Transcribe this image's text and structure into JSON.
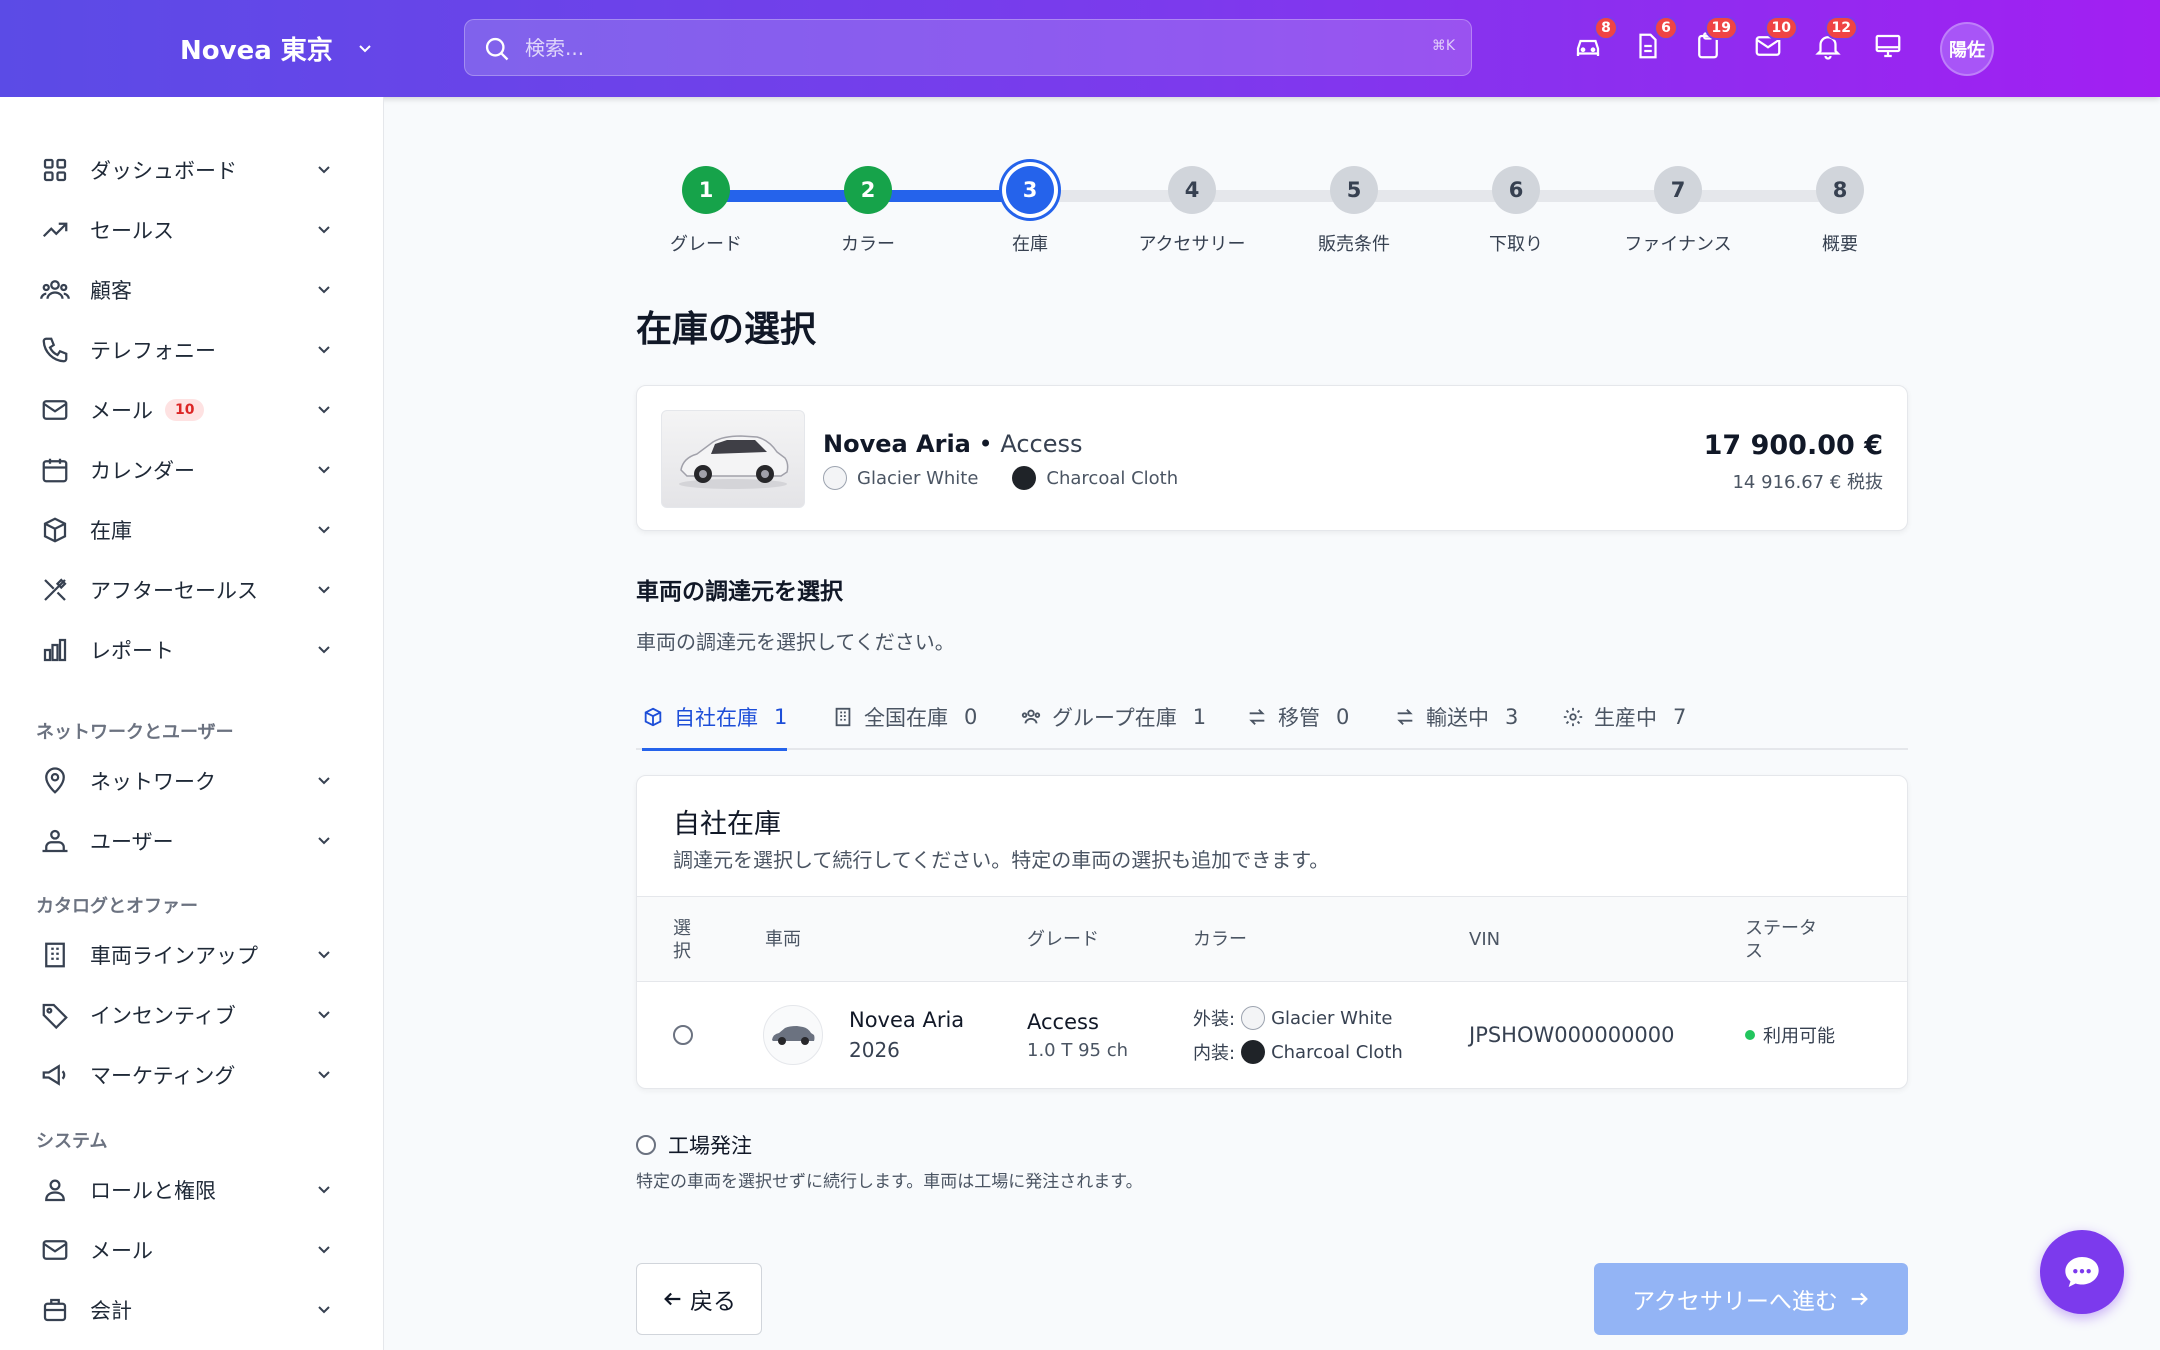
{
  "header": {
    "brand": "Novea 東京",
    "search_placeholder": "検索...",
    "search_shortcut": "⌘K",
    "icons": [
      {
        "name": "car-icon",
        "badge": "8"
      },
      {
        "name": "document-icon",
        "badge": "6"
      },
      {
        "name": "clipboard-icon",
        "badge": "19"
      },
      {
        "name": "mail-icon",
        "badge": "10"
      },
      {
        "name": "bell-icon",
        "badge": "12"
      },
      {
        "name": "monitor-icon",
        "badge": ""
      }
    ],
    "avatar": "陽佐"
  },
  "sidebar": {
    "items": [
      {
        "label": "ダッシュボード",
        "icon": "grid-icon"
      },
      {
        "label": "セールス",
        "icon": "trending-up-icon"
      },
      {
        "label": "顧客",
        "icon": "users-icon"
      },
      {
        "label": "テレフォニー",
        "icon": "phone-icon"
      },
      {
        "label": "メール",
        "icon": "mail-icon",
        "badge": "10"
      },
      {
        "label": "カレンダー",
        "icon": "calendar-icon"
      },
      {
        "label": "在庫",
        "icon": "box-icon"
      },
      {
        "label": "アフターセールス",
        "icon": "tools-icon"
      },
      {
        "label": "レポート",
        "icon": "bar-chart-icon"
      }
    ],
    "section_network": "ネットワークとユーザー",
    "network_items": [
      {
        "label": "ネットワーク",
        "icon": "map-pin-icon"
      },
      {
        "label": "ユーザー",
        "icon": "user-group-icon"
      }
    ],
    "section_catalog": "カタログとオファー",
    "catalog_items": [
      {
        "label": "車両ラインアップ",
        "icon": "building-icon"
      },
      {
        "label": "インセンティブ",
        "icon": "tag-icon"
      },
      {
        "label": "マーケティング",
        "icon": "megaphone-icon"
      }
    ],
    "section_system": "システム",
    "system_items": [
      {
        "label": "ロールと権限",
        "icon": "user-icon"
      },
      {
        "label": "メール",
        "icon": "mail-icon"
      },
      {
        "label": "会計",
        "icon": "briefcase-icon"
      }
    ]
  },
  "stepper": {
    "current": 3,
    "steps": [
      {
        "num": "1",
        "label": "グレード",
        "state": "done"
      },
      {
        "num": "2",
        "label": "カラー",
        "state": "done"
      },
      {
        "num": "3",
        "label": "在庫",
        "state": "current"
      },
      {
        "num": "4",
        "label": "アクセサリー",
        "state": "todo"
      },
      {
        "num": "5",
        "label": "販売条件",
        "state": "todo"
      },
      {
        "num": "6",
        "label": "下取り",
        "state": "todo"
      },
      {
        "num": "7",
        "label": "ファイナンス",
        "state": "todo"
      },
      {
        "num": "8",
        "label": "概要",
        "state": "todo"
      }
    ]
  },
  "main": {
    "title": "在庫の選択",
    "car": {
      "model": "Novea Aria",
      "separator": "•",
      "grade": "Access",
      "exterior_color": "Glacier White",
      "interior_color": "Charcoal Cloth",
      "price": "17 900.00 €",
      "price_ex_tax": "14 916.67 € 税抜"
    },
    "source_title": "車両の調達元を選択",
    "source_desc": "車両の調達元を選択してください。",
    "tabs": [
      {
        "label": "自社在庫",
        "count": "1",
        "icon": "box-icon",
        "active": true
      },
      {
        "label": "全国在庫",
        "count": "0",
        "icon": "building-icon",
        "active": false
      },
      {
        "label": "グループ在庫",
        "count": "1",
        "icon": "users-icon",
        "active": false
      },
      {
        "label": "移管",
        "count": "0",
        "icon": "transfer-icon",
        "active": false
      },
      {
        "label": "輸送中",
        "count": "3",
        "icon": "transfer-icon",
        "active": false
      },
      {
        "label": "生産中",
        "count": "7",
        "icon": "gear-icon",
        "active": false
      }
    ],
    "inventory": {
      "title": "自社在庫",
      "desc": "調達元を選択して続行してください。特定の車両の選択も追加できます。",
      "columns": {
        "select": "選\n択",
        "vehicle": "車両",
        "grade": "グレード",
        "color": "カラー",
        "vin": "VIN",
        "status": "ステータ\nス"
      },
      "rows": [
        {
          "model": "Novea Aria",
          "year": "2026",
          "grade": "Access",
          "engine": "1.0 T 95 ch",
          "ext_label": "外装:",
          "ext_color": "Glacier White",
          "int_label": "内装:",
          "int_color": "Charcoal Cloth",
          "vin": "JPSHOW000000000",
          "status": "利用可能"
        }
      ]
    },
    "factory_label": "工場発注",
    "factory_desc": "特定の車両を選択せずに続行します。車両は工場に発注されます。",
    "back_button": "戻る",
    "next_button": "アクセサリーへ進む"
  },
  "colors": {
    "accent": "#2563eb",
    "done": "#16a34a",
    "header_start": "#5b4be6",
    "header_end": "#a21ff2",
    "glacier_white": "#f3f4f6",
    "charcoal": "#1f2328",
    "status_available": "#22c55e"
  }
}
